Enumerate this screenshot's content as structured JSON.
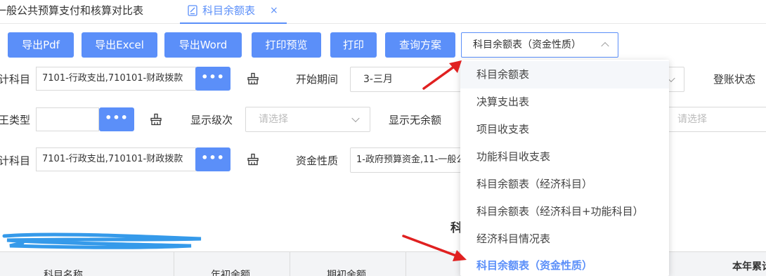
{
  "tabs": [
    {
      "label": "一般公共预算支付和核算对比表"
    },
    {
      "label": "科目余额表",
      "close": "×"
    }
  ],
  "toolbar": {
    "buttons": [
      "导出Pdf",
      "导出Excel",
      "导出Word",
      "打印预览",
      "打印",
      "查询方案"
    ],
    "scheme_select": "科目余额表（资金性质）"
  },
  "filters": {
    "row1": {
      "label_left": "计科目",
      "input_value": "7101-行政支出,710101-财政拨款",
      "more": "•••",
      "period_label": "开始期间",
      "period_value": "3-三月",
      "status_label": "登账状态"
    },
    "row2": {
      "label_left": "王类型",
      "level_label": "显示级次",
      "level_placeholder": "请选择",
      "noamount_label": "显示无余额",
      "right_placeholder": "请选择",
      "more": "•••"
    },
    "row3": {
      "label_left": "计科目",
      "input_value": "7101-行政支出,710101-财政拨款",
      "more": "•••",
      "fund_label": "资金性质",
      "fund_value": "1-政府预算资金,11-一般公"
    }
  },
  "dropdown": {
    "items": [
      "科目余额表",
      "决算支出表",
      "项目收支表",
      "功能科目收支表",
      "科目余额表（经济科目）",
      "科目余额表（经济科目+功能科目）",
      "经济科目情况表",
      "科目余额表（资金性质）"
    ],
    "hover_index": 0,
    "selected_index": 7
  },
  "report_title_fragment": "科",
  "table": {
    "headers": [
      "科目名称",
      "年初余额",
      "期初余额",
      "本年累计"
    ]
  },
  "colors": {
    "primary": "#5b8ff9",
    "arrow": "#e02020"
  }
}
